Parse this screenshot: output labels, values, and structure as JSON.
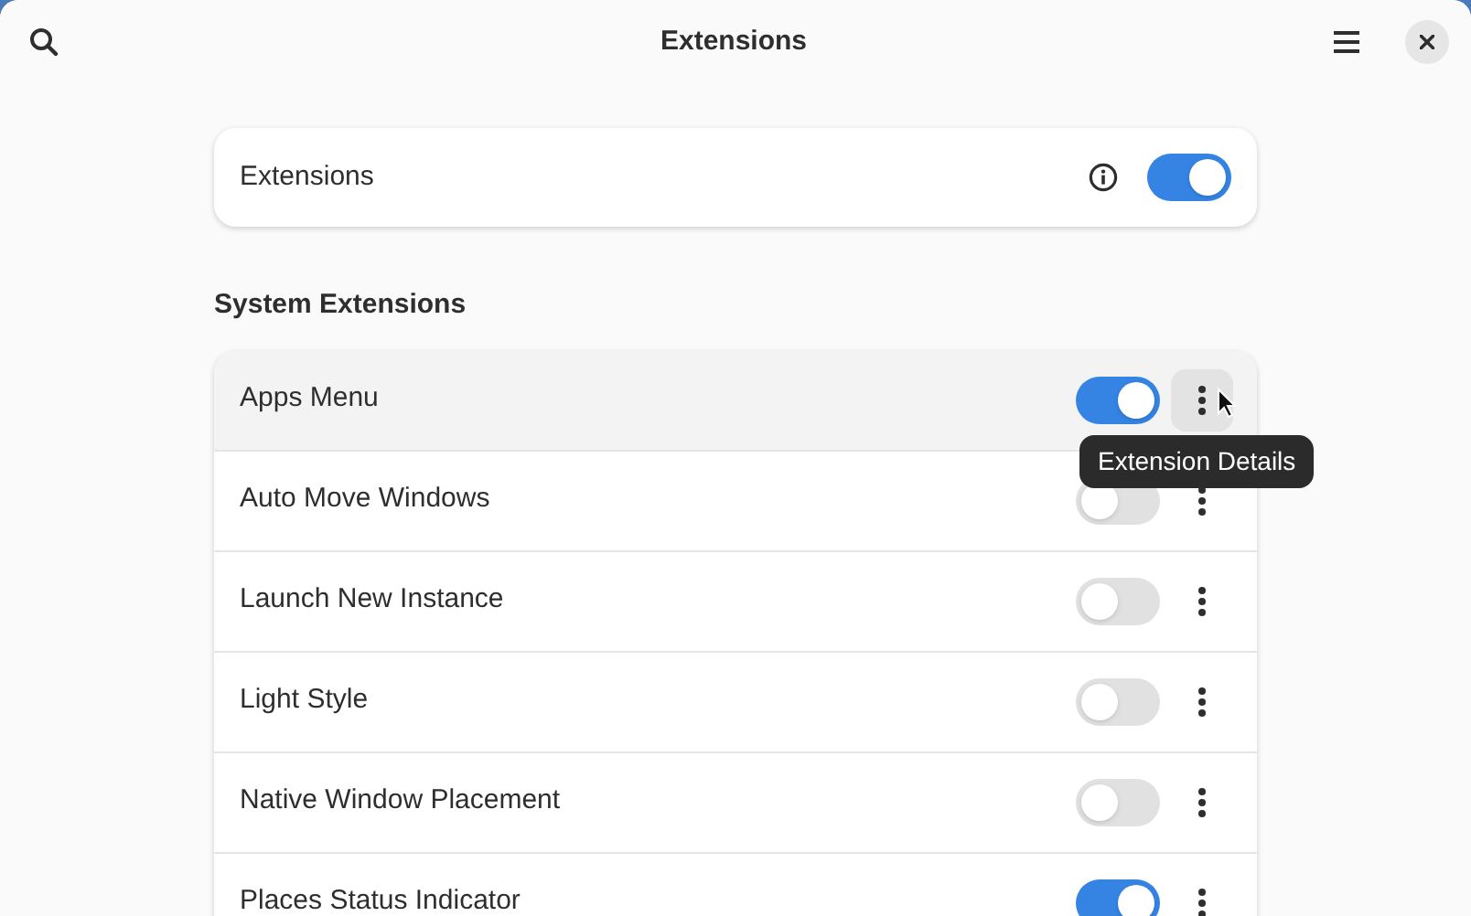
{
  "window": {
    "title": "Extensions"
  },
  "main_card": {
    "label": "Extensions",
    "on": true
  },
  "section": {
    "title": "System Extensions"
  },
  "extensions": [
    {
      "name": "Apps Menu",
      "on": true,
      "hovered": true
    },
    {
      "name": "Auto Move Windows",
      "on": false,
      "hovered": false
    },
    {
      "name": "Launch New Instance",
      "on": false,
      "hovered": false
    },
    {
      "name": "Light Style",
      "on": false,
      "hovered": false
    },
    {
      "name": "Native Window Placement",
      "on": false,
      "hovered": false
    },
    {
      "name": "Places Status Indicator",
      "on": true,
      "hovered": false
    }
  ],
  "tooltip": {
    "text": "Extension Details"
  }
}
